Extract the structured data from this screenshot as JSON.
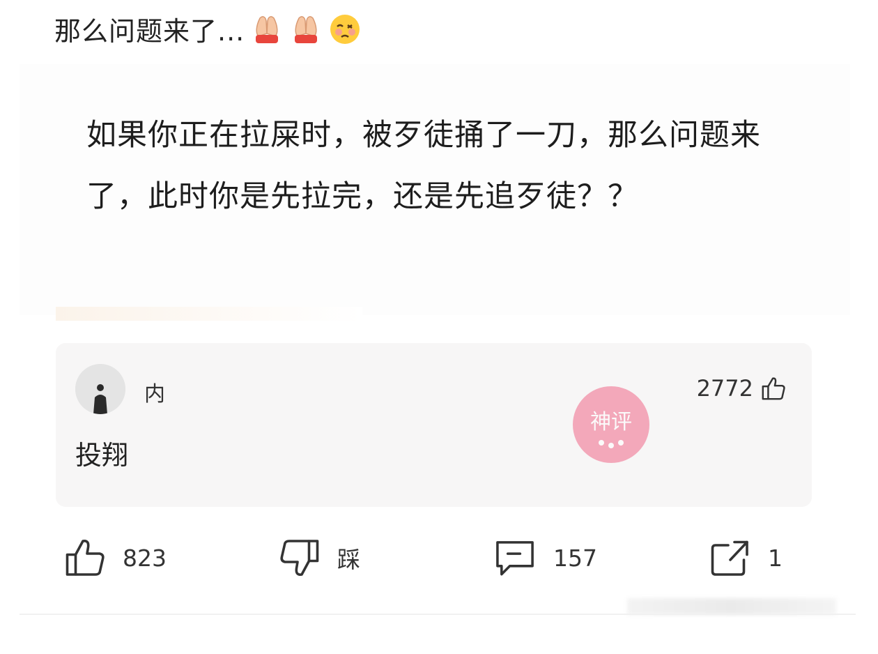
{
  "post": {
    "title": "那么问题来了...",
    "title_emojis": [
      "folded-hands-icon",
      "folded-hands-icon",
      "woozy-face-icon"
    ],
    "body": "如果你正在拉屎时，被歹徒捅了一刀，那么问题来了，此时你是先拉完，还是先追歹徒？？"
  },
  "top_comment": {
    "username": "内",
    "text": "投翔",
    "likes": "2772",
    "stamp_text": "神评"
  },
  "actions": {
    "like_count": "823",
    "dislike_label": "踩",
    "comment_count": "157",
    "share_count": "1"
  },
  "colors": {
    "stamp": "#f06a8a",
    "icon": "#333333"
  }
}
